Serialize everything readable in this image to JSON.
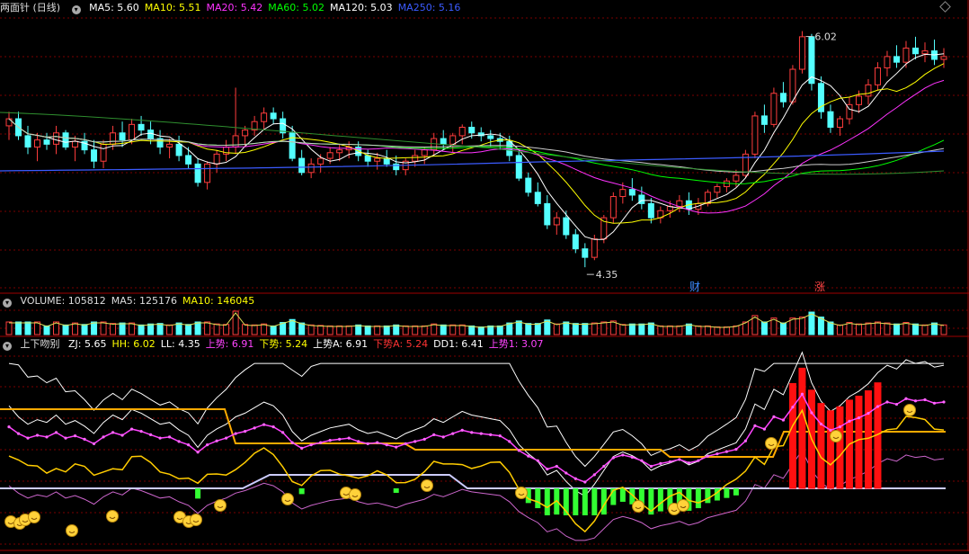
{
  "main": {
    "title": "两面针 (日线)",
    "mas": [
      {
        "label": "MA5: 5.60",
        "color": "#ffffff"
      },
      {
        "label": "MA10: 5.51",
        "color": "#ffff00"
      },
      {
        "label": "MA20: 5.42",
        "color": "#ff33ff"
      },
      {
        "label": "MA60: 5.02",
        "color": "#00ff00"
      },
      {
        "label": "MA120: 5.03",
        "color": "#ffffff"
      },
      {
        "label": "MA250: 5.16",
        "color": "#3b5bff"
      }
    ],
    "high_label": "6.02",
    "low_label": "4.35",
    "markers": [
      {
        "text": "财",
        "color": "#3b8bff"
      },
      {
        "text": "涨",
        "color": "#ff4444"
      }
    ]
  },
  "volume": {
    "items": [
      {
        "label": "VOLUME: 105812",
        "color": "#dddddd"
      },
      {
        "label": "MA5: 125176",
        "color": "#dddddd"
      },
      {
        "label": "MA10: 146045",
        "color": "#ffff00"
      }
    ]
  },
  "indicator": {
    "title": "上下吻别",
    "items": [
      {
        "label": "ZJ: 5.65",
        "color": "#ffffff"
      },
      {
        "label": "HH: 6.02",
        "color": "#ffff00"
      },
      {
        "label": "LL: 4.35",
        "color": "#ffffff"
      },
      {
        "label": "上势: 6.91",
        "color": "#ff44ff"
      },
      {
        "label": "下势: 5.24",
        "color": "#ffff00"
      },
      {
        "label": "上势A: 6.91",
        "color": "#ffffff"
      },
      {
        "label": "下势A: 5.24",
        "color": "#ff3333"
      },
      {
        "label": "DD1: 6.41",
        "color": "#ffffff"
      },
      {
        "label": "上势1: 3.07",
        "color": "#ff44ff"
      }
    ]
  },
  "chart_data": {
    "type": "candlestick",
    "series_meta": "daily OHLC, approximate readings",
    "ohlc": [
      [
        5.35,
        5.45,
        5.25,
        5.4
      ],
      [
        5.4,
        5.45,
        5.25,
        5.28
      ],
      [
        5.28,
        5.35,
        5.15,
        5.2
      ],
      [
        5.2,
        5.3,
        5.1,
        5.25
      ],
      [
        5.25,
        5.3,
        5.18,
        5.22
      ],
      [
        5.22,
        5.35,
        5.15,
        5.3
      ],
      [
        5.3,
        5.32,
        5.18,
        5.2
      ],
      [
        5.2,
        5.28,
        5.1,
        5.24
      ],
      [
        5.24,
        5.3,
        5.15,
        5.18
      ],
      [
        5.18,
        5.25,
        5.05,
        5.1
      ],
      [
        5.1,
        5.25,
        5.05,
        5.22
      ],
      [
        5.22,
        5.35,
        5.18,
        5.3
      ],
      [
        5.3,
        5.38,
        5.2,
        5.25
      ],
      [
        5.25,
        5.4,
        5.22,
        5.36
      ],
      [
        5.36,
        5.42,
        5.28,
        5.32
      ],
      [
        5.32,
        5.38,
        5.22,
        5.26
      ],
      [
        5.26,
        5.32,
        5.15,
        5.2
      ],
      [
        5.2,
        5.26,
        5.12,
        5.22
      ],
      [
        5.22,
        5.28,
        5.1,
        5.14
      ],
      [
        5.14,
        5.2,
        5.05,
        5.08
      ],
      [
        5.08,
        5.12,
        4.92,
        4.95
      ],
      [
        4.95,
        5.1,
        4.9,
        5.08
      ],
      [
        5.08,
        5.18,
        5.02,
        5.15
      ],
      [
        5.15,
        5.25,
        5.1,
        5.2
      ],
      [
        5.2,
        5.62,
        5.15,
        5.28
      ],
      [
        5.28,
        5.35,
        5.2,
        5.32
      ],
      [
        5.32,
        5.42,
        5.28,
        5.38
      ],
      [
        5.38,
        5.48,
        5.32,
        5.44
      ],
      [
        5.44,
        5.48,
        5.36,
        5.4
      ],
      [
        5.4,
        5.45,
        5.26,
        5.3
      ],
      [
        5.3,
        5.35,
        5.1,
        5.12
      ],
      [
        5.12,
        5.18,
        5.0,
        5.02
      ],
      [
        5.02,
        5.12,
        4.98,
        5.08
      ],
      [
        5.08,
        5.15,
        5.02,
        5.12
      ],
      [
        5.12,
        5.2,
        5.08,
        5.16
      ],
      [
        5.16,
        5.22,
        5.1,
        5.18
      ],
      [
        5.18,
        5.24,
        5.12,
        5.2
      ],
      [
        5.2,
        5.24,
        5.1,
        5.14
      ],
      [
        5.14,
        5.18,
        5.06,
        5.1
      ],
      [
        5.1,
        5.16,
        5.04,
        5.12
      ],
      [
        5.12,
        5.18,
        5.06,
        5.08
      ],
      [
        5.08,
        5.14,
        5.0,
        5.04
      ],
      [
        5.04,
        5.12,
        5.0,
        5.1
      ],
      [
        5.1,
        5.18,
        5.06,
        5.14
      ],
      [
        5.14,
        5.2,
        5.08,
        5.18
      ],
      [
        5.18,
        5.3,
        5.14,
        5.26
      ],
      [
        5.26,
        5.32,
        5.18,
        5.22
      ],
      [
        5.22,
        5.3,
        5.16,
        5.28
      ],
      [
        5.28,
        5.36,
        5.22,
        5.34
      ],
      [
        5.34,
        5.38,
        5.26,
        5.3
      ],
      [
        5.3,
        5.34,
        5.24,
        5.28
      ],
      [
        5.28,
        5.32,
        5.2,
        5.26
      ],
      [
        5.26,
        5.3,
        5.18,
        5.24
      ],
      [
        5.24,
        5.28,
        5.1,
        5.14
      ],
      [
        5.14,
        5.18,
        4.96,
        4.98
      ],
      [
        4.98,
        5.02,
        4.85,
        4.88
      ],
      [
        4.88,
        4.95,
        4.78,
        4.8
      ],
      [
        4.8,
        4.86,
        4.62,
        4.65
      ],
      [
        4.65,
        4.74,
        4.58,
        4.7
      ],
      [
        4.7,
        4.75,
        4.55,
        4.58
      ],
      [
        4.58,
        4.62,
        4.45,
        4.48
      ],
      [
        4.48,
        4.52,
        4.35,
        4.42
      ],
      [
        4.42,
        4.58,
        4.4,
        4.55
      ],
      [
        4.55,
        4.72,
        4.52,
        4.7
      ],
      [
        4.7,
        4.88,
        4.66,
        4.85
      ],
      [
        4.85,
        4.95,
        4.8,
        4.9
      ],
      [
        4.9,
        4.98,
        4.82,
        4.86
      ],
      [
        4.86,
        4.92,
        4.76,
        4.8
      ],
      [
        4.8,
        4.84,
        4.66,
        4.7
      ],
      [
        4.7,
        4.78,
        4.66,
        4.75
      ],
      [
        4.75,
        4.82,
        4.7,
        4.78
      ],
      [
        4.78,
        4.86,
        4.74,
        4.82
      ],
      [
        4.82,
        4.88,
        4.72,
        4.76
      ],
      [
        4.76,
        4.84,
        4.72,
        4.8
      ],
      [
        4.8,
        4.9,
        4.78,
        4.88
      ],
      [
        4.88,
        4.94,
        4.84,
        4.92
      ],
      [
        4.92,
        4.98,
        4.88,
        4.96
      ],
      [
        4.96,
        5.04,
        4.92,
        5.0
      ],
      [
        5.0,
        5.18,
        4.98,
        5.15
      ],
      [
        5.15,
        5.45,
        5.12,
        5.42
      ],
      [
        5.42,
        5.5,
        5.3,
        5.36
      ],
      [
        5.36,
        5.62,
        5.34,
        5.58
      ],
      [
        5.58,
        5.66,
        5.48,
        5.52
      ],
      [
        5.52,
        5.78,
        5.5,
        5.75
      ],
      [
        5.75,
        6.02,
        5.72,
        5.98
      ],
      [
        5.98,
        6.0,
        5.6,
        5.65
      ],
      [
        5.65,
        5.7,
        5.4,
        5.45
      ],
      [
        5.45,
        5.5,
        5.3,
        5.34
      ],
      [
        5.34,
        5.42,
        5.28,
        5.4
      ],
      [
        5.4,
        5.55,
        5.36,
        5.5
      ],
      [
        5.5,
        5.6,
        5.44,
        5.56
      ],
      [
        5.56,
        5.68,
        5.5,
        5.64
      ],
      [
        5.64,
        5.8,
        5.6,
        5.76
      ],
      [
        5.76,
        5.88,
        5.7,
        5.84
      ],
      [
        5.84,
        5.92,
        5.76,
        5.8
      ],
      [
        5.8,
        5.95,
        5.76,
        5.9
      ],
      [
        5.9,
        5.98,
        5.82,
        5.86
      ],
      [
        5.86,
        5.94,
        5.8,
        5.88
      ],
      [
        5.88,
        5.96,
        5.78,
        5.82
      ],
      [
        5.82,
        5.9,
        5.76,
        5.84
      ]
    ]
  }
}
